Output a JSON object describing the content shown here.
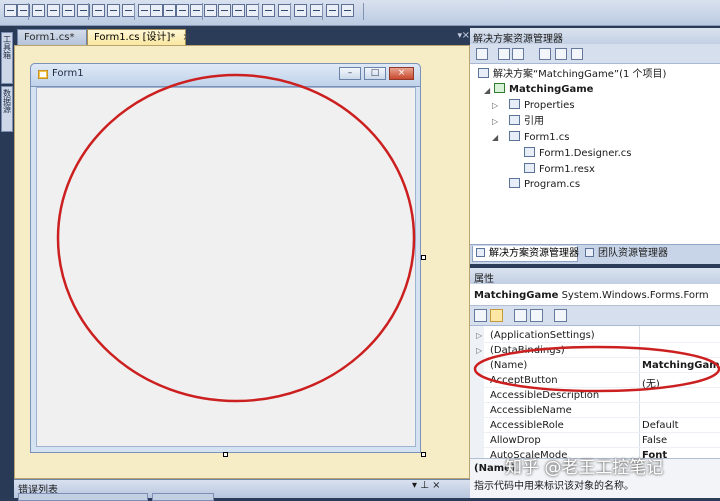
{
  "toolbar": {
    "icons": [
      "align-lefts-icon",
      "align-centers-icon",
      "align-rights-icon",
      "align-tops-icon",
      "align-middles-icon",
      "align-bottoms-icon",
      "make-same-width-icon",
      "make-same-height-icon",
      "make-same-size-icon",
      "size-to-grid-icon",
      "horizontal-spacing-equal-icon",
      "increase-horizontal-spacing-icon",
      "decrease-horizontal-spacing-icon",
      "remove-horizontal-spacing-icon",
      "vertical-spacing-equal-icon",
      "increase-vertical-spacing-icon",
      "decrease-vertical-spacing-icon",
      "remove-vertical-spacing-icon",
      "center-horizontally-icon",
      "center-vertically-icon",
      "bring-to-front-icon",
      "send-to-back-icon",
      "tab-order-icon",
      "toolbar-options-icon"
    ]
  },
  "left_strip": {
    "tabs": [
      {
        "label": "工具箱",
        "icon": "toolbox-icon"
      },
      {
        "label": "数据源",
        "icon": "data-sources-icon"
      }
    ]
  },
  "doc_tabs": [
    {
      "label": "Form1.cs*",
      "active": false
    },
    {
      "label": "Form1.cs [设计]*",
      "active": true,
      "close": "×"
    }
  ],
  "doc_tabs_controls": {
    "dropdown": "▾",
    "close": "×"
  },
  "form": {
    "title": "Form1",
    "icon": "form-icon",
    "buttons": {
      "minimize": "–",
      "maximize": "□",
      "close": "×"
    }
  },
  "solution_explorer": {
    "title": "解决方案资源管理器",
    "toolbar_icons": [
      "properties-icon",
      "show-all-files-icon",
      "refresh-icon",
      "view-code-icon",
      "view-designer-icon",
      "view-class-diagram-icon"
    ],
    "tree": [
      {
        "label": "解决方案“MatchingGame”(1 个项目)",
        "icon": "solution-icon",
        "level": 0
      },
      {
        "label": "MatchingGame",
        "icon": "csharp-project-icon",
        "level": 1,
        "expanded": true,
        "bold": true
      },
      {
        "label": "Properties",
        "icon": "properties-folder-icon",
        "level": 2,
        "expandable": true
      },
      {
        "label": "引用",
        "icon": "references-icon",
        "level": 2,
        "expandable": true
      },
      {
        "label": "Form1.cs",
        "icon": "form-file-icon",
        "level": 2,
        "expanded": true
      },
      {
        "label": "Form1.Designer.cs",
        "icon": "cs-file-icon",
        "level": 3
      },
      {
        "label": "Form1.resx",
        "icon": "resx-file-icon",
        "level": 3
      },
      {
        "label": "Program.cs",
        "icon": "cs-file-icon",
        "level": 2
      }
    ],
    "tabs": [
      {
        "label": "解决方案资源管理器",
        "icon": "solution-explorer-icon",
        "active": true
      },
      {
        "label": "团队资源管理器",
        "icon": "team-explorer-icon",
        "active": false
      }
    ]
  },
  "properties": {
    "title": "属性",
    "object_name": "MatchingGame",
    "object_type": "System.Windows.Forms.Form",
    "toolbar_icons": [
      "categorized-icon",
      "alphabetical-icon",
      "properties-view-icon",
      "events-icon",
      "property-pages-icon"
    ],
    "rows": [
      {
        "name": "(ApplicationSettings)",
        "value": "",
        "expandable": true
      },
      {
        "name": "(DataBindings)",
        "value": "",
        "expandable": true
      },
      {
        "name": "(Name)",
        "value": "MatchingGame",
        "bold": true
      },
      {
        "name": "AcceptButton",
        "value": "(无)"
      },
      {
        "name": "AccessibleDescription",
        "value": ""
      },
      {
        "name": "AccessibleName",
        "value": ""
      },
      {
        "name": "AccessibleRole",
        "value": "Default"
      },
      {
        "name": "AllowDrop",
        "value": "False"
      },
      {
        "name": "AutoScaleMode",
        "value": "Font"
      }
    ],
    "description": {
      "name": "(Name)",
      "text": "指示代码中用来标识该对象的名称。"
    }
  },
  "error_list": {
    "title": "错误列表",
    "controls": "▾ ⊥ ×"
  },
  "watermark": "知乎 @老王工控笔记",
  "colors": {
    "annotation_red": "#cc1f1f",
    "active_tab": "#f9e7a0",
    "ide_frame": "#2b3c59"
  }
}
